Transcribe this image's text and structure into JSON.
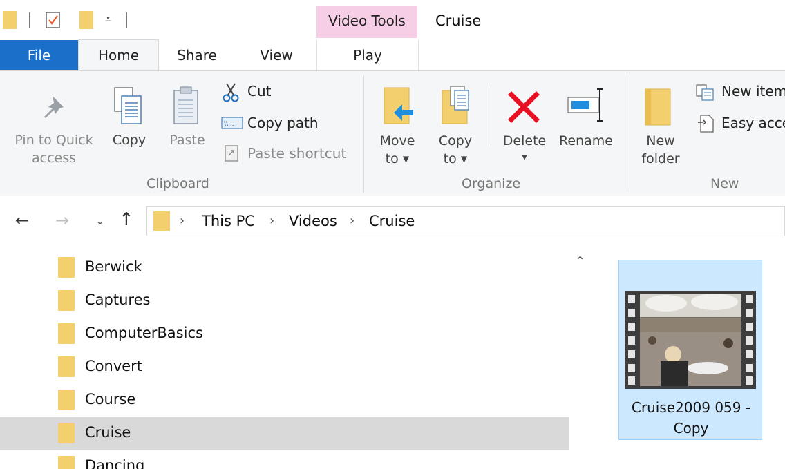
{
  "titlebar": {
    "context_tab_group": "Video Tools",
    "window_title": "Cruise"
  },
  "tabs": [
    {
      "label": "File"
    },
    {
      "label": "Home"
    },
    {
      "label": "Share"
    },
    {
      "label": "View"
    },
    {
      "label": "Play"
    }
  ],
  "ribbon": {
    "clipboard": {
      "group_label": "Clipboard",
      "pin_label_1": "Pin to Quick",
      "pin_label_2": "access",
      "copy_label": "Copy",
      "paste_label": "Paste",
      "cut_label": "Cut",
      "copy_path_label": "Copy path",
      "paste_shortcut_label": "Paste shortcut"
    },
    "organize": {
      "group_label": "Organize",
      "move_to_1": "Move",
      "move_to_2": "to ▾",
      "copy_to_1": "Copy",
      "copy_to_2": "to ▾",
      "delete_label": "Delete",
      "delete_arrow": "▾",
      "rename_label": "Rename"
    },
    "new": {
      "group_label": "New",
      "new_folder_1": "New",
      "new_folder_2": "folder",
      "new_item_label": "New item",
      "easy_access_label": "Easy access"
    }
  },
  "address": {
    "breadcrumbs": [
      "This PC",
      "Videos",
      "Cruise"
    ]
  },
  "nav_pane": {
    "items": [
      {
        "label": "Berwick"
      },
      {
        "label": "Captures"
      },
      {
        "label": "ComputerBasics"
      },
      {
        "label": "Convert"
      },
      {
        "label": "Course"
      },
      {
        "label": "Cruise"
      },
      {
        "label": "Dancing"
      }
    ],
    "selected": "Cruise"
  },
  "content": {
    "file_name_line1": "Cruise2009 059 -",
    "file_name_line2": "Copy"
  },
  "colors": {
    "file_tab": "#1a6fc9",
    "video_tools_tab": "#f6cfe7",
    "folder": "#f3cf6d",
    "selection": "#cce8ff",
    "delete_x": "#e81123",
    "arrow_blue": "#1e8ee0"
  }
}
